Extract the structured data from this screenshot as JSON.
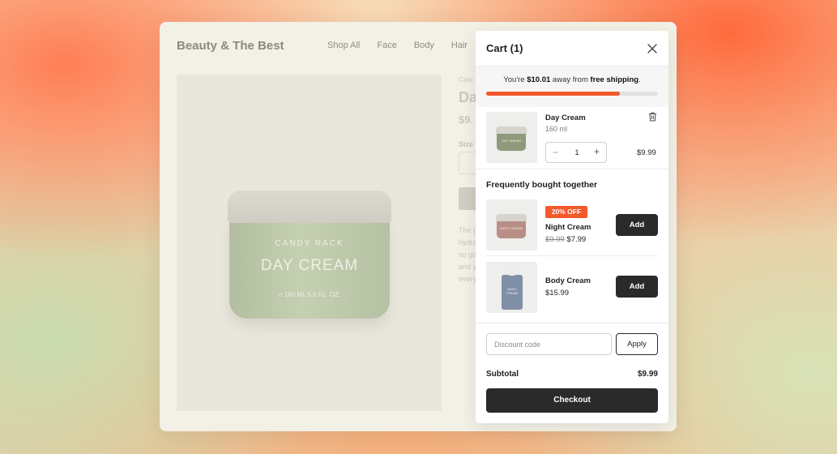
{
  "store": {
    "brand": "Beauty & The Best",
    "nav": [
      "Shop All",
      "Face",
      "Body",
      "Hair"
    ]
  },
  "product": {
    "jar_brand": "CANDY RACK",
    "jar_name": "DAY CREAM",
    "jar_volume": "℮ 160 ML 5.5 FL. OZ.",
    "category_fragment": "Canc",
    "title_fragment": "Da",
    "price_fragment": "$9.",
    "size_label_fragment": "Size",
    "description_fragments": [
      "The (",
      "hydra",
      "so go",
      "and y",
      "every"
    ]
  },
  "cart": {
    "title": "Cart (1)",
    "shipping_prefix": "You're ",
    "shipping_amount": "$10.01",
    "shipping_middle": " away from ",
    "shipping_goal": "free shipping",
    "shipping_suffix": ".",
    "shipping_progress": 0.78,
    "accent_color": "#f4592c",
    "item": {
      "name": "Day Cream",
      "size": "160 ml",
      "quantity": "1",
      "price": "$9.99",
      "thumb_label": "DAY CREAM",
      "thumb_color": "#8e9a7a"
    },
    "fbt_title": "Frequently bought together",
    "recommendations": [
      {
        "badge": "20% OFF",
        "name": "Night Cream",
        "old_price": "$9.99",
        "price": "$7.99",
        "add_label": "Add",
        "thumb_label": "NIGHT CREAM",
        "thumb_color": "#b98e86"
      },
      {
        "name": "Body Cream",
        "price": "$15.99",
        "add_label": "Add",
        "thumb_label": "BODY CREAM"
      }
    ],
    "discount_placeholder": "Discount code",
    "apply_label": "Apply",
    "subtotal_label": "Subtotal",
    "subtotal_value": "$9.99",
    "checkout_label": "Checkout"
  },
  "icons": {
    "close": "close-icon",
    "trash": "trash-icon",
    "minus": "minus-icon",
    "plus": "plus-icon"
  }
}
